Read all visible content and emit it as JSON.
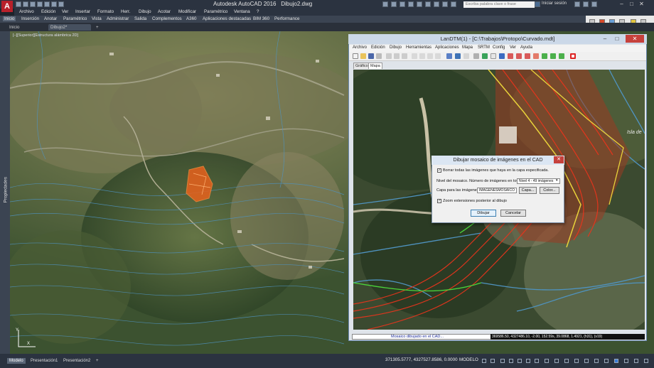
{
  "app": {
    "title": "Autodesk AutoCAD 2016",
    "document": "Dibujo2.dwg",
    "logo": "A",
    "search_placeholder": "Escriba palabra clave o frase",
    "login": "Iniciar sesión",
    "window_controls": [
      "–",
      "□",
      "✕"
    ]
  },
  "menubar": [
    "Archivo",
    "Edición",
    "Ver",
    "Insertar",
    "Formato",
    "Herr.",
    "Dibujo",
    "Acotar",
    "Modificar",
    "Paramétrico",
    "Ventana",
    "?"
  ],
  "ribbon_tabs": [
    "Inicio",
    "Inserción",
    "Anotar",
    "Paramétrico",
    "Vista",
    "Administrar",
    "Salida",
    "Complementos",
    "A360",
    "Aplicaciones destacadas",
    "BIM 360",
    "Performance"
  ],
  "file_tabs": [
    "Inicio",
    "Dibujo2*",
    "+"
  ],
  "palette_label": "Propiedades",
  "viewport_label": "[–][Superior][Estructura alámbrica 2D]",
  "ucs": {
    "y": "Y",
    "x": "X"
  },
  "landtm": {
    "title": "LanDTM(1) - [C:\\Trabajos\\Protopo\\Curvado.mdt]",
    "menus": [
      "Archivo",
      "Edición",
      "Dibujo",
      "Herramientas",
      "Aplicaciones",
      "Mapa",
      "SRTM",
      "Config",
      "Ver",
      "Ayuda"
    ],
    "tabs": [
      "Gráfico",
      "Mapa"
    ],
    "map_label": "Isla de",
    "status_message": "Mosaico dibujado en el CAD...",
    "status_coords": "369586.50, 4327486.10, -2.00, 152.59s, 39.0868, 1.4921, (h31), (v19)"
  },
  "dialog": {
    "title": "Dibujar mosaico de imágenes en el CAD",
    "close": "✕",
    "opt_delete": {
      "label": "Borrar todas las imágenes que haya en la capa especificada.",
      "checked": true
    },
    "level_label": "Nivel del mosaico. Número de imágenes en total",
    "level_value": "Nivel 4 - 49 imágenes",
    "layer_label": "Capa para las imágenes",
    "layer_value": "IMAGENESMOSAICO",
    "layer_button": "Capa...",
    "color_button": "Color...",
    "opt_zoom": {
      "label": "Zoom extensiones posterior al dibujo",
      "checked": true
    },
    "ok": "Dibujar",
    "cancel": "Cancelar"
  },
  "bottom": {
    "tabs": [
      "Modelo",
      "Presentación1",
      "Presentación2",
      "+"
    ],
    "coords": "371305.5777, 4327527.8586, 0.0000",
    "mode": "MODELO"
  },
  "colors": {
    "accent_red": "#b8202a",
    "contour_blue": "#4f93c0",
    "highlight_orange": "#e8611c",
    "road_yellow": "#d9c23a",
    "green_line": "#4bd43a"
  }
}
